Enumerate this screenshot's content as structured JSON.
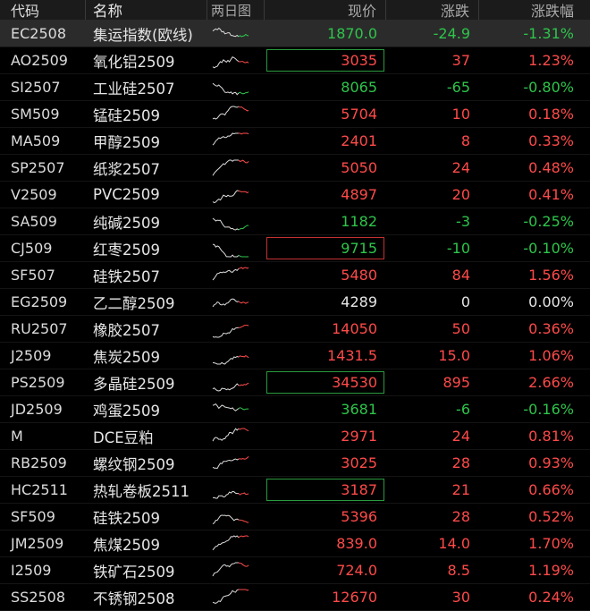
{
  "header": {
    "code": "代码",
    "name": "名称",
    "chart": "两日图",
    "price": "现价",
    "change": "涨跌",
    "pct": "涨跌幅"
  },
  "colors": {
    "up": "#ff4a4a",
    "down": "#2ec54b",
    "flat": "#e6e6e6",
    "background": "#000000"
  },
  "rows": [
    {
      "code": "EC2508",
      "name": "集运指数(欧线)",
      "price": "1870.0",
      "change": "-24.9",
      "pct": "-1.31%",
      "dir": "down",
      "box": "none",
      "selected": true
    },
    {
      "code": "AO2509",
      "name": "氧化铝2509",
      "price": "3035",
      "change": "37",
      "pct": "1.23%",
      "dir": "up",
      "box": "down"
    },
    {
      "code": "SI2507",
      "name": "工业硅2507",
      "price": "8065",
      "change": "-65",
      "pct": "-0.80%",
      "dir": "down",
      "box": "none"
    },
    {
      "code": "SM509",
      "name": "锰硅2509",
      "price": "5704",
      "change": "10",
      "pct": "0.18%",
      "dir": "up",
      "box": "none"
    },
    {
      "code": "MA509",
      "name": "甲醇2509",
      "price": "2401",
      "change": "8",
      "pct": "0.33%",
      "dir": "up",
      "box": "none"
    },
    {
      "code": "SP2507",
      "name": "纸浆2507",
      "price": "5050",
      "change": "24",
      "pct": "0.48%",
      "dir": "up",
      "box": "none"
    },
    {
      "code": "V2509",
      "name": "PVC2509",
      "price": "4897",
      "change": "20",
      "pct": "0.41%",
      "dir": "up",
      "box": "none"
    },
    {
      "code": "SA509",
      "name": "纯碱2509",
      "price": "1182",
      "change": "-3",
      "pct": "-0.25%",
      "dir": "down",
      "box": "none"
    },
    {
      "code": "CJ509",
      "name": "红枣2509",
      "price": "9715",
      "change": "-10",
      "pct": "-0.10%",
      "dir": "down",
      "box": "up"
    },
    {
      "code": "SF507",
      "name": "硅铁2507",
      "price": "5480",
      "change": "84",
      "pct": "1.56%",
      "dir": "up",
      "box": "none"
    },
    {
      "code": "EG2509",
      "name": "乙二醇2509",
      "price": "4289",
      "change": "0",
      "pct": "0.00%",
      "dir": "flat",
      "box": "none"
    },
    {
      "code": "RU2507",
      "name": "橡胶2507",
      "price": "14050",
      "change": "50",
      "pct": "0.36%",
      "dir": "up",
      "box": "none"
    },
    {
      "code": "J2509",
      "name": "焦炭2509",
      "price": "1431.5",
      "change": "15.0",
      "pct": "1.06%",
      "dir": "up",
      "box": "none"
    },
    {
      "code": "PS2509",
      "name": "多晶硅2509",
      "price": "34530",
      "change": "895",
      "pct": "2.66%",
      "dir": "up",
      "box": "down"
    },
    {
      "code": "JD2509",
      "name": "鸡蛋2509",
      "price": "3681",
      "change": "-6",
      "pct": "-0.16%",
      "dir": "down",
      "box": "none"
    },
    {
      "code": "M",
      "name": "DCE豆粕",
      "price": "2971",
      "change": "24",
      "pct": "0.81%",
      "dir": "up",
      "box": "none"
    },
    {
      "code": "RB2509",
      "name": "螺纹钢2509",
      "price": "3025",
      "change": "28",
      "pct": "0.93%",
      "dir": "up",
      "box": "none"
    },
    {
      "code": "HC2511",
      "name": "热轧卷板2511",
      "price": "3187",
      "change": "21",
      "pct": "0.66%",
      "dir": "up",
      "box": "down"
    },
    {
      "code": "SF509",
      "name": "硅铁2509",
      "price": "5396",
      "change": "28",
      "pct": "0.52%",
      "dir": "up",
      "box": "none"
    },
    {
      "code": "JM2509",
      "name": "焦煤2509",
      "price": "839.0",
      "change": "14.0",
      "pct": "1.70%",
      "dir": "up",
      "box": "none"
    },
    {
      "code": "I2509",
      "name": "铁矿石2509",
      "price": "724.0",
      "change": "8.5",
      "pct": "1.19%",
      "dir": "up",
      "box": "none"
    },
    {
      "code": "SS2508",
      "name": "不锈钢2508",
      "price": "12670",
      "change": "30",
      "pct": "0.24%",
      "dir": "up",
      "box": "none"
    }
  ]
}
